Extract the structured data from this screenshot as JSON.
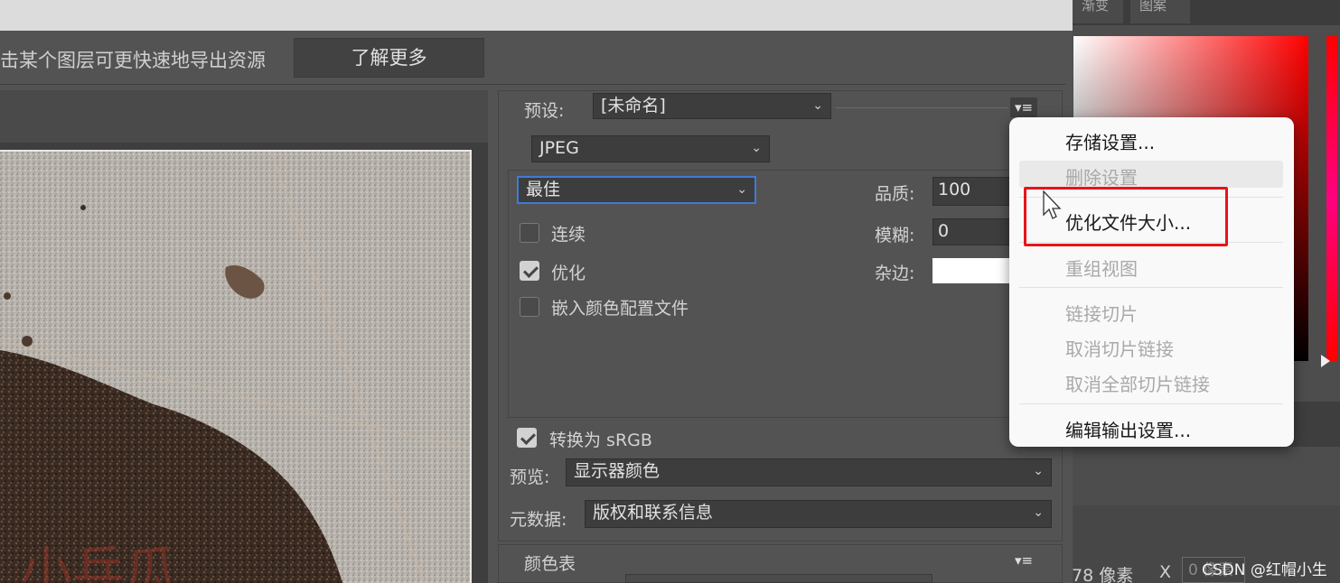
{
  "hint_bar": {
    "text": "击某个图层可更快速地导出资源",
    "learn_more": "了解更多"
  },
  "right_panel": {
    "tabs": [
      "渐变",
      "图案"
    ],
    "pixel_value": "78 像素",
    "x_label": "X",
    "x_value": "0 像素"
  },
  "settings": {
    "preset_label": "预设:",
    "preset_value": "[未命名]",
    "format_value": "JPEG",
    "quality_preset": "最佳",
    "quality_label": "品质:",
    "quality_value": "100",
    "blur_label": "模糊:",
    "blur_value": "0",
    "matte_label": "杂边:",
    "matte_color": "#ffffff",
    "progressive_label": "连续",
    "progressive_checked": false,
    "optimize_label": "优化",
    "optimize_checked": true,
    "embed_profile_label": "嵌入颜色配置文件",
    "embed_profile_checked": false,
    "convert_srgb_label": "转换为 sRGB",
    "convert_srgb_checked": true,
    "preview_label": "预览:",
    "preview_value": "显示器颜色",
    "metadata_label": "元数据:",
    "metadata_value": "版权和联系信息",
    "color_table_label": "颜色表"
  },
  "menu": {
    "items": [
      {
        "label": "存储设置...",
        "enabled": true
      },
      {
        "label": "删除设置",
        "enabled": false
      },
      {
        "label": "优化文件大小...",
        "enabled": true,
        "highlighted": true
      },
      {
        "label": "重组视图",
        "enabled": false
      },
      {
        "label": "链接切片",
        "enabled": false
      },
      {
        "label": "取消切片链接",
        "enabled": false
      },
      {
        "label": "取消全部切片链接",
        "enabled": false
      },
      {
        "label": "编辑输出设置...",
        "enabled": true
      }
    ]
  },
  "preview_watermark": "小兵瓜",
  "watermark": "CSDN @红帽小生",
  "colors": {
    "highlight_box": "#e8141a",
    "focus_border": "#3e7bd6"
  }
}
